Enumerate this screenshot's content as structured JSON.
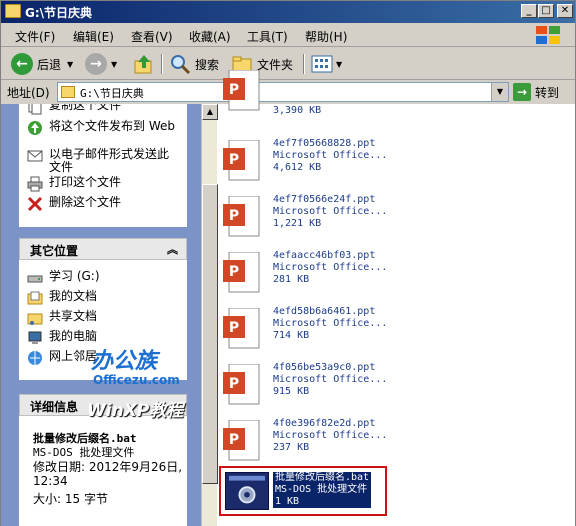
{
  "window": {
    "title": "G:\\节日庆典"
  },
  "menu": [
    "文件(F)",
    "编辑(E)",
    "查看(V)",
    "收藏(A)",
    "工具(T)",
    "帮助(H)"
  ],
  "toolbar": {
    "back": "后退",
    "search": "搜索",
    "folders": "文件夹"
  },
  "address": {
    "label": "地址(D)",
    "value": "G:\\节日庆典",
    "go": "转到"
  },
  "file_tasks": [
    "复制这个文件",
    "将这个文件发布到 Web",
    "以电子邮件形式发送此文件",
    "打印这个文件",
    "删除这个文件"
  ],
  "other_places": {
    "header": "其它位置",
    "items": [
      "学习 (G:)",
      "我的文档",
      "共享文档",
      "我的电脑",
      "网上邻居"
    ]
  },
  "details": {
    "header": "详细信息",
    "filename": "批量修改后缀名.bat",
    "filetype": "MS-DOS 批处理文件",
    "modified": "修改日期: 2012年9月26日, 12:34",
    "size": "大小: 15 字节"
  },
  "watermark": {
    "brand": "办公族",
    "site": "Officezu.com",
    "tag": "WinXP教程"
  },
  "files": [
    {
      "name": "",
      "type": "",
      "size": "3,390 KB"
    },
    {
      "name": "4ef7f05668828.ppt",
      "type": "Microsoft Office...",
      "size": "4,612 KB"
    },
    {
      "name": "4ef7f0566e24f.ppt",
      "type": "Microsoft Office...",
      "size": "1,221 KB"
    },
    {
      "name": "4efaacc46bf03.ppt",
      "type": "Microsoft Office...",
      "size": "281 KB"
    },
    {
      "name": "4efd58b6a6461.ppt",
      "type": "Microsoft Office...",
      "size": "714 KB"
    },
    {
      "name": "4f056be53a9c0.ppt",
      "type": "Microsoft Office...",
      "size": "915 KB"
    },
    {
      "name": "4f0e396f82e2d.ppt",
      "type": "Microsoft Office...",
      "size": "237 KB"
    }
  ],
  "selected_file": {
    "name": "批量修改后缀名.bat",
    "type": "MS-DOS 批处理文件",
    "size": "1 KB"
  }
}
